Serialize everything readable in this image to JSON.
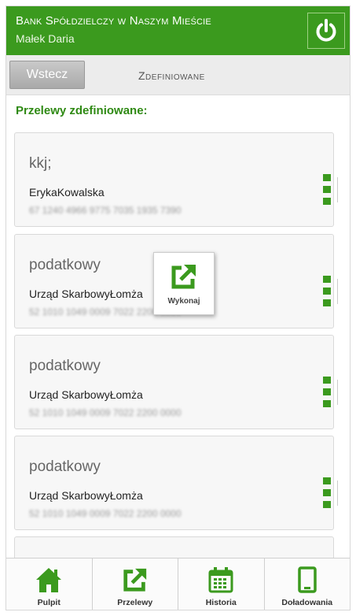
{
  "header": {
    "bank_name": "Bank Spółdzielczy w Naszym Mieście",
    "user_name": "Małek Daria"
  },
  "subbar": {
    "back_label": "Wstecz",
    "title": "Zdefiniowane"
  },
  "section_title": "Przelewy zdefiniowane:",
  "transfers": [
    {
      "name": "kkj;",
      "recipient": "ErykaKowalska",
      "account": "67 1240 4966 9775 7035 1935 7390"
    },
    {
      "name": "podatkowy",
      "recipient": "Urząd SkarbowyŁomża",
      "account": "52 1010 1049 0009 7022 2200 0000"
    },
    {
      "name": "podatkowy",
      "recipient": "Urząd SkarbowyŁomża",
      "account": "52 1010 1049 0009 7022 2200 0000"
    },
    {
      "name": "podatkowy",
      "recipient": "Urząd SkarbowyŁomża",
      "account": "52 1010 1049 0009 7022 2200 0000"
    }
  ],
  "popup": {
    "label": "Wykonaj",
    "icon": "execute-transfer-icon"
  },
  "nav": [
    {
      "label": "Pulpit",
      "icon": "home-icon"
    },
    {
      "label": "Przelewy",
      "icon": "transfer-icon"
    },
    {
      "label": "Historia",
      "icon": "calendar-icon"
    },
    {
      "label": "Doładowania",
      "icon": "phone-icon"
    }
  ],
  "colors": {
    "brand_green": "#3b9a1e",
    "header_text": "#ffffff"
  }
}
